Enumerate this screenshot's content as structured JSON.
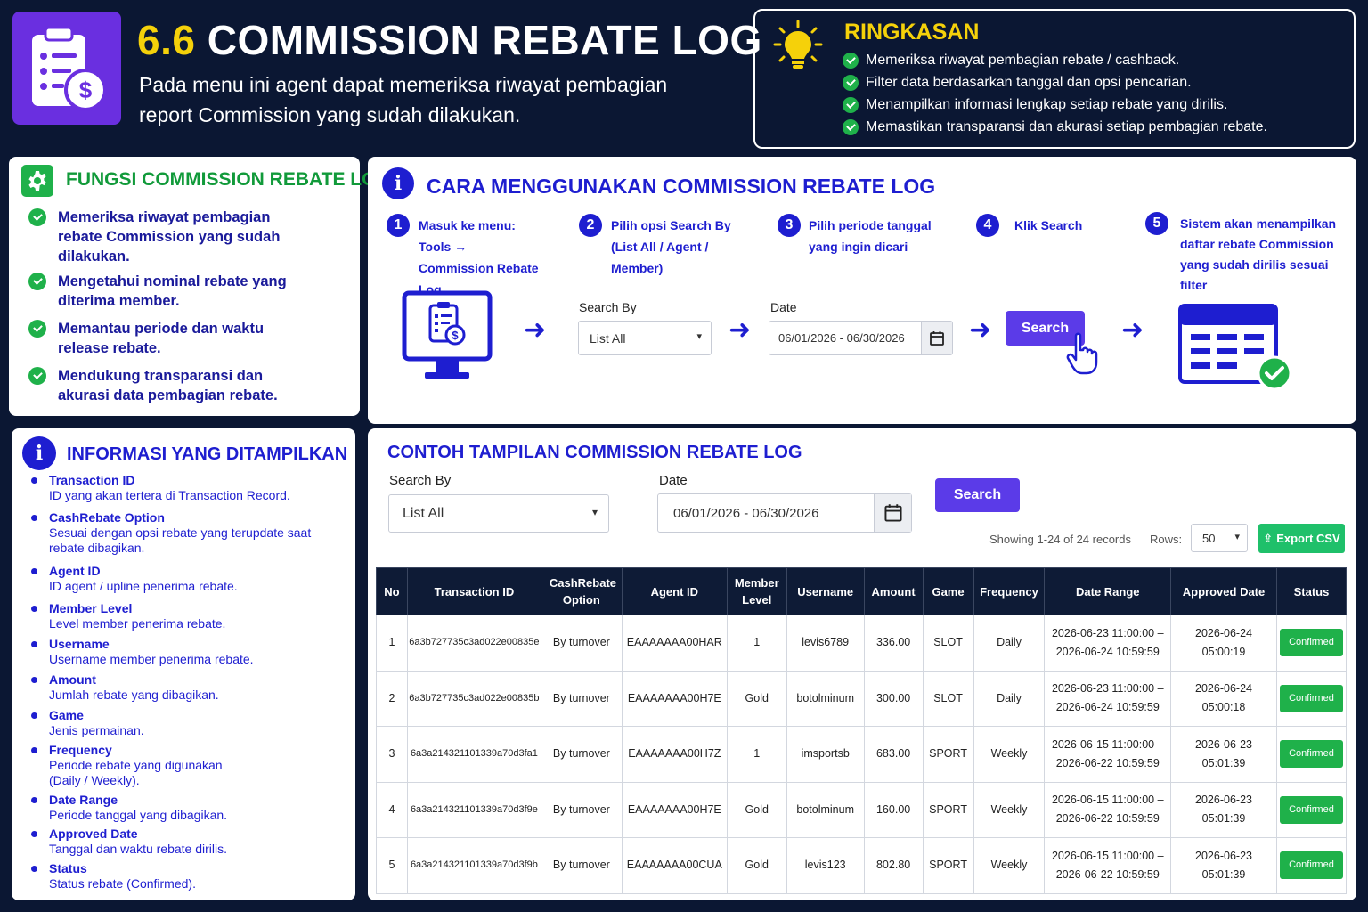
{
  "header": {
    "number": "6.6",
    "title": "COMMISSION REBATE LOG",
    "subtitle": "Pada menu ini agent dapat memeriksa riwayat pembagian report Commission yang sudah dilakukan."
  },
  "summary": {
    "title": "RINGKASAN",
    "items": [
      "Memeriksa riwayat pembagian rebate / cashback.",
      "Filter data berdasarkan tanggal dan opsi pencarian.",
      "Menampilkan informasi lengkap setiap rebate yang dirilis.",
      "Memastikan transparansi dan akurasi setiap pembagian rebate."
    ]
  },
  "fungsi": {
    "title": "FUNGSI COMMISSION REBATE LOG",
    "items": [
      "Memeriksa riwayat pembagian rebate Commission yang sudah dilakukan.",
      "Mengetahui nominal rebate yang diterima member.",
      "Memantau periode dan waktu release rebate.",
      "Mendukung transparansi dan akurasi data pembagian rebate."
    ]
  },
  "cara": {
    "title": "CARA MENGGUNAKAN COMMISSION REBATE LOG",
    "steps": [
      {
        "num": "1",
        "text": "Masuk ke menu: Tools → Commission Rebate Log"
      },
      {
        "num": "2",
        "text": "Pilih opsi Search By (List All / Agent / Member)"
      },
      {
        "num": "3",
        "text": "Pilih periode tanggal yang ingin dicari"
      },
      {
        "num": "4",
        "text": "Klik Search"
      },
      {
        "num": "5",
        "text": "Sistem akan menampilkan daftar rebate Commission yang sudah dirilis sesuai filter"
      }
    ],
    "search_by_label": "Search By",
    "search_by_value": "List All",
    "date_label": "Date",
    "date_value": "06/01/2026 - 06/30/2026",
    "search_button": "Search"
  },
  "info": {
    "title": "INFORMASI YANG DITAMPILKAN",
    "items": [
      {
        "name": "Transaction ID",
        "desc": "ID yang akan tertera di Transaction Record."
      },
      {
        "name": "CashRebate Option",
        "desc": "Sesuai dengan opsi rebate yang terupdate saat rebate dibagikan."
      },
      {
        "name": "Agent ID",
        "desc": "ID agent / upline penerima rebate."
      },
      {
        "name": "Member Level",
        "desc": "Level member penerima rebate."
      },
      {
        "name": "Username",
        "desc": "Username member penerima rebate."
      },
      {
        "name": "Amount",
        "desc": "Jumlah rebate yang dibagikan."
      },
      {
        "name": "Game",
        "desc": "Jenis permainan."
      },
      {
        "name": "Frequency",
        "desc": "Periode rebate yang digunakan (Daily / Weekly)."
      },
      {
        "name": "Date Range",
        "desc": "Periode tanggal yang dibagikan."
      },
      {
        "name": "Approved Date",
        "desc": "Tanggal dan waktu rebate dirilis."
      },
      {
        "name": "Status",
        "desc": "Status rebate (Confirmed)."
      }
    ]
  },
  "contoh": {
    "title": "CONTOH TAMPILAN COMMISSION REBATE LOG",
    "search_by_label": "Search By",
    "search_by_value": "List All",
    "date_label": "Date",
    "date_value": "06/01/2026 - 06/30/2026",
    "search_button": "Search",
    "showing": "Showing 1-24 of 24 records",
    "rows_label": "Rows:",
    "rows_value": "50",
    "export_button": "Export CSV",
    "columns": [
      "No",
      "Transaction ID",
      "CashRebate Option",
      "Agent ID",
      "Member Level",
      "Username",
      "Amount",
      "Game",
      "Frequency",
      "Date Range",
      "Approved Date",
      "Status"
    ],
    "rows": [
      [
        "1",
        "6a3b727735c3ad022e00835e",
        "By turnover",
        "EAAAAAAA00HAR",
        "1",
        "levis6789",
        "336.00",
        "SLOT",
        "Daily",
        "2026-06-23 11:00:00 – 2026-06-24 10:59:59",
        "2026-06-24 05:00:19",
        "Confirmed"
      ],
      [
        "2",
        "6a3b727735c3ad022e00835b",
        "By turnover",
        "EAAAAAAA00H7E",
        "Gold",
        "botolminum",
        "300.00",
        "SLOT",
        "Daily",
        "2026-06-23 11:00:00 – 2026-06-24 10:59:59",
        "2026-06-24 05:00:18",
        "Confirmed"
      ],
      [
        "3",
        "6a3a214321101339a70d3fa1",
        "By turnover",
        "EAAAAAAA00H7Z",
        "1",
        "imsportsb",
        "683.00",
        "SPORT",
        "Weekly",
        "2026-06-15 11:00:00 – 2026-06-22 10:59:59",
        "2026-06-23 05:01:39",
        "Confirmed"
      ],
      [
        "4",
        "6a3a214321101339a70d3f9e",
        "By turnover",
        "EAAAAAAA00H7E",
        "Gold",
        "botolminum",
        "160.00",
        "SPORT",
        "Weekly",
        "2026-06-15 11:00:00 – 2026-06-22 10:59:59",
        "2026-06-23 05:01:39",
        "Confirmed"
      ],
      [
        "5",
        "6a3a214321101339a70d3f9b",
        "By turnover",
        "EAAAAAAA00CUA",
        "Gold",
        "levis123",
        "802.80",
        "SPORT",
        "Weekly",
        "2026-06-15 11:00:00 – 2026-06-22 10:59:59",
        "2026-06-23 05:01:39",
        "Confirmed"
      ]
    ]
  },
  "icons": [
    "clipboard-dollar-icon",
    "lightbulb-icon",
    "gear-icon",
    "info-icon",
    "monitor-icon",
    "calendar-icon",
    "cursor-hand-icon",
    "table-check-icon",
    "export-icon",
    "chevron-down-icon"
  ],
  "colors": {
    "background": "#0b1733",
    "accent": "#5b3be8",
    "heading_blue": "#1e1ed0",
    "title_yellow": "#f5d10a",
    "green": "#1fb14a"
  }
}
